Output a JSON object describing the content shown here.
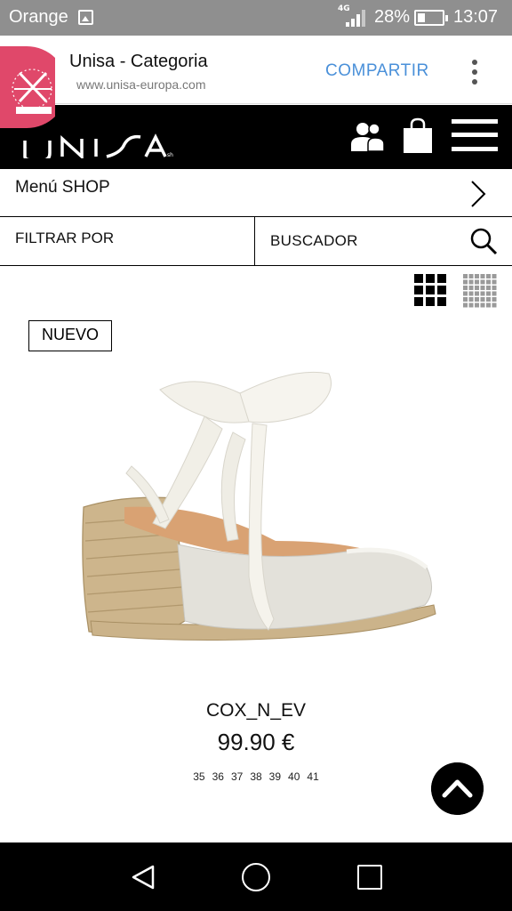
{
  "status_bar": {
    "carrier": "Orange",
    "network": "4G",
    "battery_percent": "28%",
    "battery_level": 0.28,
    "time": "13:07"
  },
  "browser": {
    "page_title": "Unisa - Categoria",
    "url": "www.unisa-europa.com",
    "share_label": "COMPARTIR",
    "badge_text_line1": "HAND MADE",
    "badge_text_line2": "ESPAÑA"
  },
  "header": {
    "logo_text": "UNISA",
    "icons": [
      "users-icon",
      "shopping-bag-icon",
      "hamburger-menu-icon"
    ]
  },
  "nav": {
    "menu_shop_label": "Menú SHOP",
    "filter_label": "FILTRAR POR",
    "search_label": "BUSCADOR"
  },
  "product": {
    "badge": "NUEVO",
    "name": "COX_N_EV",
    "price": "99.90 €",
    "sizes": [
      "35",
      "36",
      "37",
      "38",
      "39",
      "40",
      "41"
    ]
  },
  "colors": {
    "status_bar": "#8f8f8f",
    "header": "#000000",
    "accent_link": "#4a90d9",
    "badge_pink": "#e0486a"
  }
}
